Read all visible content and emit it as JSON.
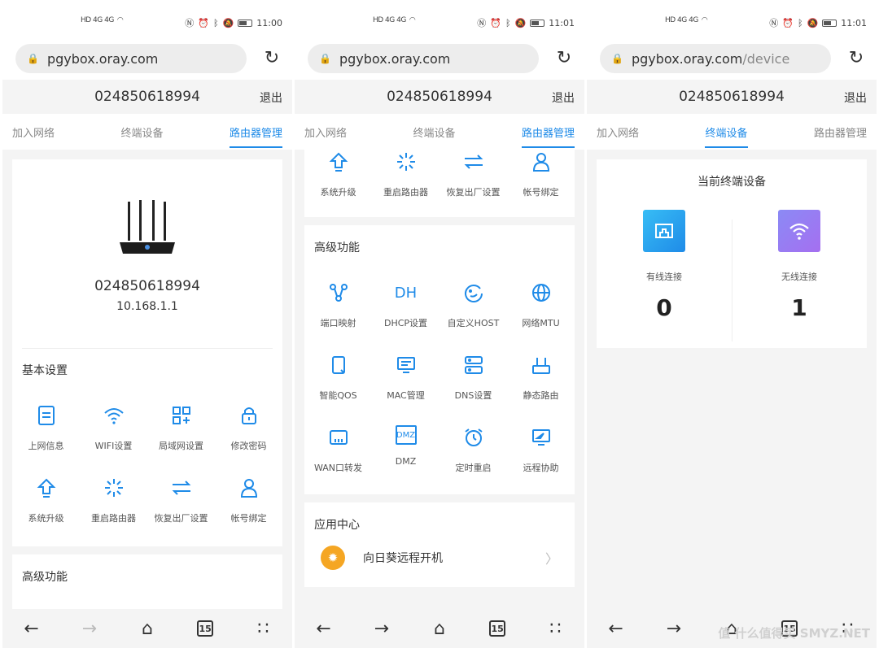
{
  "status": {
    "left_text": "HD 4G 4G",
    "time_1": "11:00",
    "time_2": "11:01",
    "time_3": "11:01"
  },
  "phones": [
    {
      "url_host": "pgybox.oray.com",
      "url_path": ""
    },
    {
      "url_host": "pgybox.oray.com",
      "url_path": ""
    },
    {
      "url_host": "pgybox.oray.com",
      "url_path": "/device"
    }
  ],
  "header": {
    "device_id": "024850618994",
    "logout_label": "退出"
  },
  "tabs": {
    "join": "加入网络",
    "terminals": "终端设备",
    "router": "路由器管理"
  },
  "router_info": {
    "name": "024850618994",
    "ip": "10.168.1.1"
  },
  "basic": {
    "title": "基本设置",
    "items": [
      {
        "label": "上网信息",
        "icon": "document-icon"
      },
      {
        "label": "WIFI设置",
        "icon": "wifi-icon"
      },
      {
        "label": "局域网设置",
        "icon": "lan-icon"
      },
      {
        "label": "修改密码",
        "icon": "lock-icon"
      },
      {
        "label": "系统升级",
        "icon": "upgrade-icon"
      },
      {
        "label": "重启路由器",
        "icon": "restart-icon"
      },
      {
        "label": "恢复出厂设置",
        "icon": "reset-icon"
      },
      {
        "label": "帐号绑定",
        "icon": "user-icon"
      }
    ]
  },
  "advanced": {
    "title": "高级功能",
    "items": [
      {
        "label": "端口映射",
        "icon": "port-mapping-icon"
      },
      {
        "label": "DHCP设置",
        "icon": "dhcp-icon"
      },
      {
        "label": "自定义HOST",
        "icon": "host-icon"
      },
      {
        "label": "网络MTU",
        "icon": "globe-icon"
      },
      {
        "label": "智能QOS",
        "icon": "qos-icon"
      },
      {
        "label": "MAC管理",
        "icon": "monitor-icon"
      },
      {
        "label": "DNS设置",
        "icon": "dns-icon"
      },
      {
        "label": "静态路由",
        "icon": "route-icon"
      },
      {
        "label": "WAN口转发",
        "icon": "wan-icon"
      },
      {
        "label": "DMZ",
        "icon": "dmz-icon"
      },
      {
        "label": "定时重启",
        "icon": "alarm-icon"
      },
      {
        "label": "远程协助",
        "icon": "remote-icon"
      }
    ]
  },
  "app_center": {
    "title": "应用中心",
    "app_name": "向日葵远程开机",
    "chevron": "〉"
  },
  "devices": {
    "title": "当前终端设备",
    "wired_label": "有线连接",
    "wired_count": "0",
    "wireless_label": "无线连接",
    "wireless_count": "1"
  },
  "navbar": {
    "tab_count": "15"
  },
  "watermark": "值 什么值得买 SMYZ.NET",
  "colors": {
    "accent": "#1f8be8",
    "wired_tile": "#1f8be8",
    "wifi_tile": "#a56ff0",
    "app_logo": "#f5a623"
  }
}
